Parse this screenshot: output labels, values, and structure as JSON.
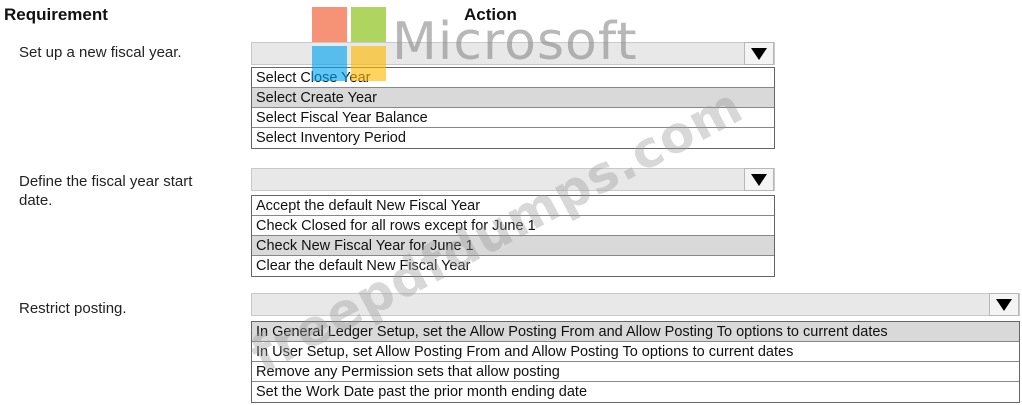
{
  "headers": {
    "requirement": "Requirement",
    "action": "Action"
  },
  "rows": [
    {
      "requirement": "Set up a new fiscal year.",
      "options": [
        "Select Close Year",
        "Select Create Year",
        "Select Fiscal Year Balance",
        "Select Inventory Period"
      ],
      "highlighted_option": "Select Create Year"
    },
    {
      "requirement": "Define the fiscal year start date.",
      "options": [
        "Accept the default New Fiscal Year",
        "Check Closed for all rows except for June 1",
        "Check New Fiscal Year for June 1",
        "Clear the default New Fiscal Year"
      ],
      "highlighted_option": "Check New Fiscal Year for June 1"
    },
    {
      "requirement": "Restrict posting.",
      "options": [
        "In General Ledger Setup, set the Allow Posting From and Allow Posting To options to current dates",
        "In User Setup, set Allow Posting From and Allow Posting To options to current dates",
        "Remove any Permission sets that allow posting",
        "Set the Work Date past the prior month ending date"
      ],
      "highlighted_option": "In General Ledger Setup, set the Allow Posting From and Allow Posting To options to current dates"
    }
  ],
  "watermark": {
    "logo_text": "Microsoft",
    "diagonal_text": "freepdfdumps.com"
  },
  "icons": {
    "dropdown": "triangle-down-icon"
  },
  "colors": {
    "logo_red": "#f25022",
    "logo_green": "#7fba00",
    "logo_blue": "#00a4ef",
    "logo_yellow": "#ffb900",
    "highlight": "#d9d9d9"
  }
}
